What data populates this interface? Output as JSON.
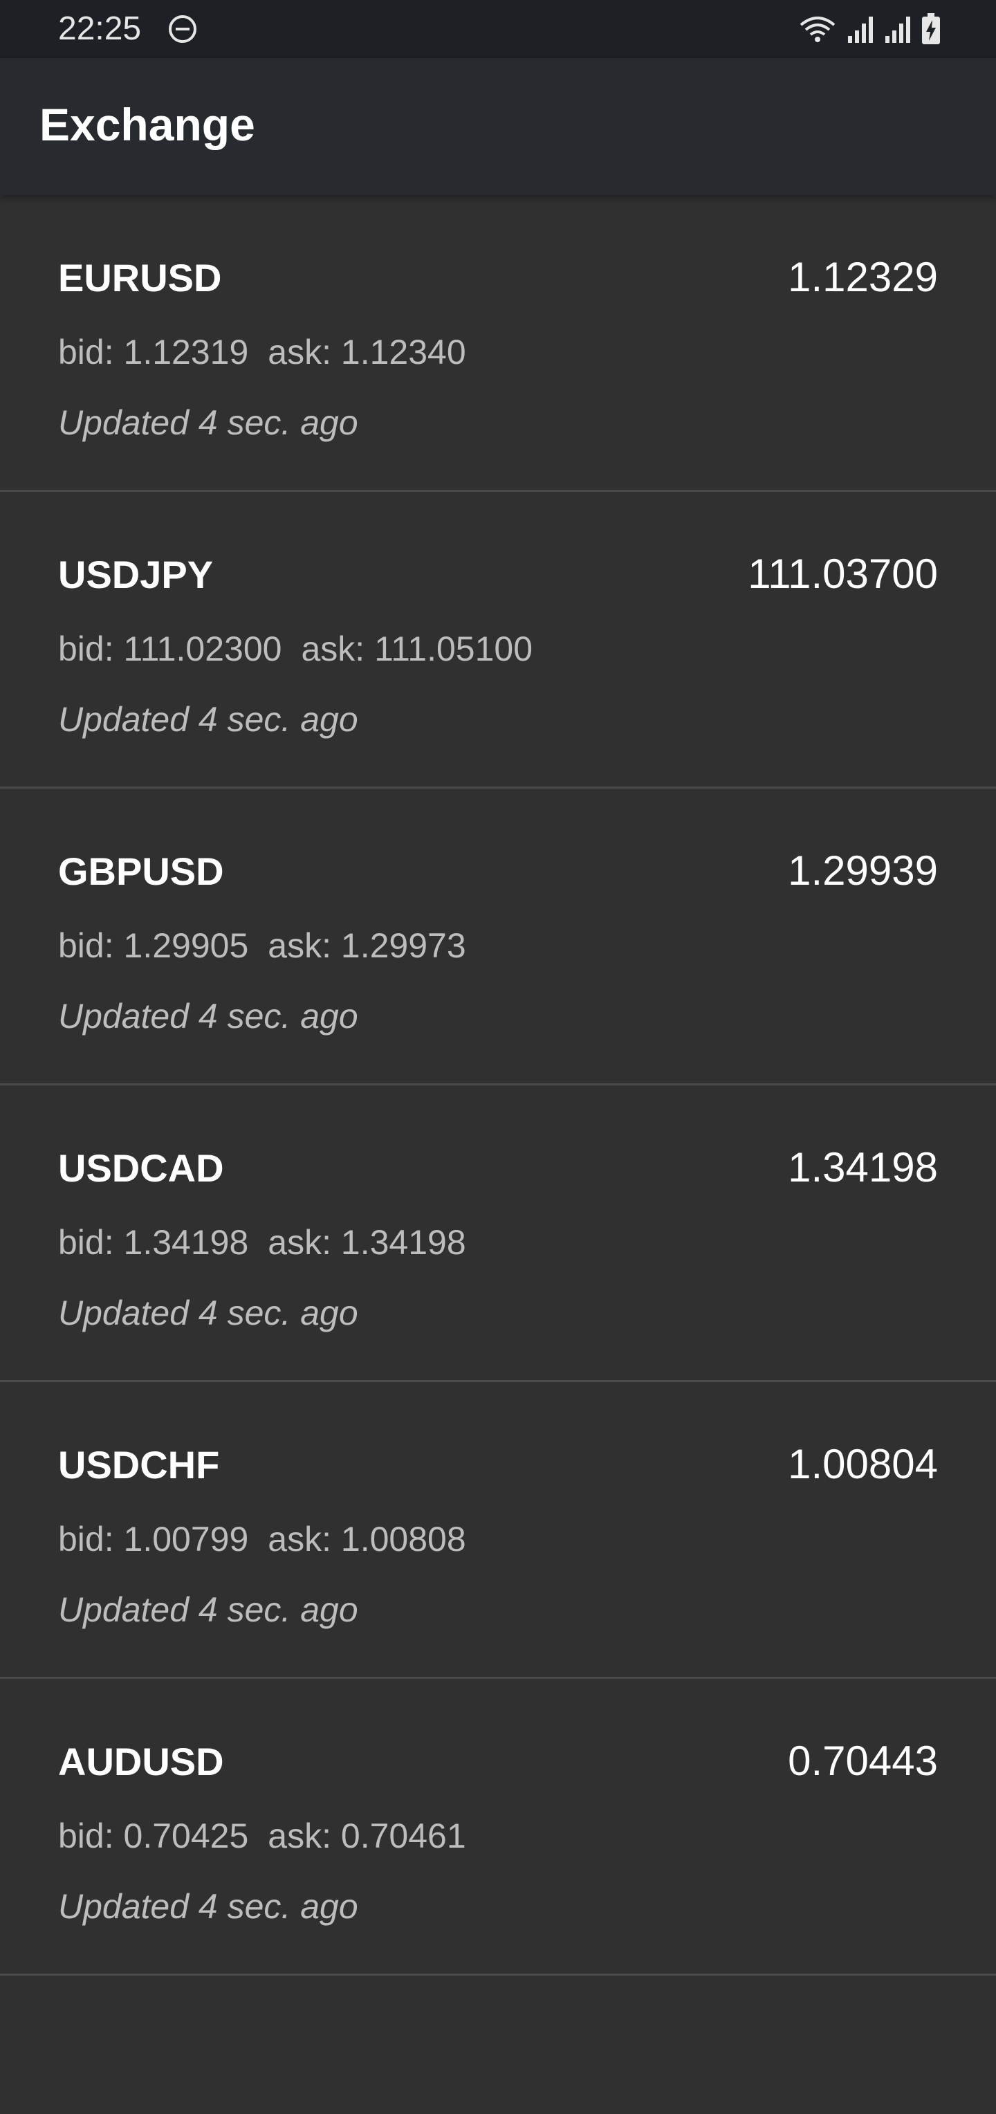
{
  "status_bar": {
    "time": "22:25",
    "icons": [
      "do-not-disturb-icon",
      "wifi-icon",
      "signal-icon",
      "signal-icon",
      "battery-charging-icon"
    ]
  },
  "app_bar": {
    "title": "Exchange"
  },
  "labels": {
    "bid": "bid:",
    "ask": "ask:"
  },
  "rates": [
    {
      "symbol": "EURUSD",
      "rate": "1.12329",
      "bid": "1.12319",
      "ask": "1.12340",
      "updated": "Updated 4 sec. ago"
    },
    {
      "symbol": "USDJPY",
      "rate": "111.03700",
      "bid": "111.02300",
      "ask": "111.05100",
      "updated": "Updated 4 sec. ago"
    },
    {
      "symbol": "GBPUSD",
      "rate": "1.29939",
      "bid": "1.29905",
      "ask": "1.29973",
      "updated": "Updated 4 sec. ago"
    },
    {
      "symbol": "USDCAD",
      "rate": "1.34198",
      "bid": "1.34198",
      "ask": "1.34198",
      "updated": "Updated 4 sec. ago"
    },
    {
      "symbol": "USDCHF",
      "rate": "1.00804",
      "bid": "1.00799",
      "ask": "1.00808",
      "updated": "Updated 4 sec. ago"
    },
    {
      "symbol": "AUDUSD",
      "rate": "0.70443",
      "bid": "0.70425",
      "ask": "0.70461",
      "updated": "Updated 4 sec. ago"
    }
  ],
  "colors": {
    "background": "#303030",
    "app_bar": "#272a2e",
    "status_bar": "#1d2024",
    "primary_text": "#ffffff",
    "secondary_text": "#bdbdbd",
    "divider": "#4a4a4a"
  }
}
